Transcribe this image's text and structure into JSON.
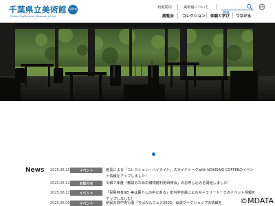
{
  "header": {
    "logo_title": "千葉県立美術館",
    "logo_badge": "50th",
    "logo_subtitle": "Chiba Prefectural Museum of Art",
    "utility_links": [
      "利用案内",
      "美術館について"
    ],
    "search_placeholder": "検索",
    "nav": [
      "展覧会",
      "コレクション",
      "体験と学び",
      "つながる"
    ]
  },
  "hero": {
    "slide_dot_count": 1
  },
  "news": {
    "title": "News",
    "items": [
      {
        "date": "2025.06.15",
        "category": "イベント",
        "text": "館長による「コレクション・ハイライト」スライドトークwith NOKISAKI COFFEEのイベント情報をアップしました！"
      },
      {
        "date": "2025.06.12",
        "category": "お知らせ",
        "text": "令和７年度「教員のための博物館利用研修会」のお申し込みを開始しました！"
      },
      {
        "date": "2025.06.12",
        "category": "イベント",
        "text": "「民藝MINGEI 美は暮らしの中にある」担当学芸員によるギャラリートークのイベント情報をアップしました！"
      },
      {
        "date": "2025.06.09",
        "category": "イベント",
        "text": "県民の日中央行事「ちばみんフェス2025」出張ワークショップの情報を"
      }
    ]
  },
  "watermark": "©MDATA"
}
